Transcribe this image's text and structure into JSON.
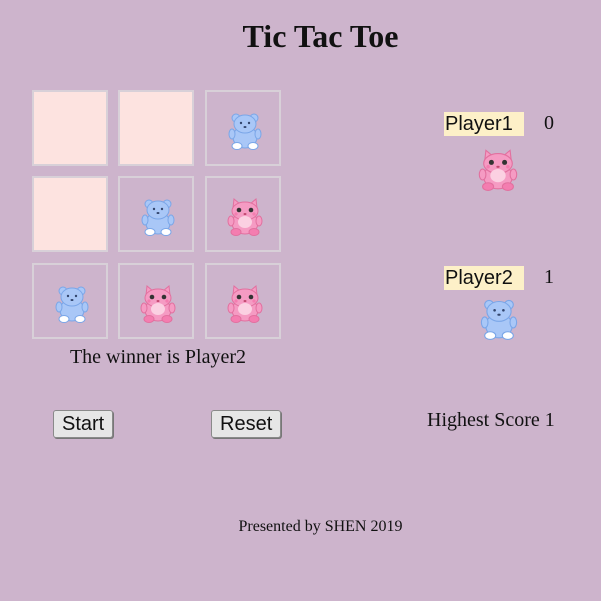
{
  "title": "Tic Tac Toe",
  "board": {
    "cells": [
      "",
      "",
      "blue",
      "",
      "blue",
      "pink",
      "blue",
      "pink",
      "pink"
    ]
  },
  "status": "The winner is Player2",
  "buttons": {
    "start": "Start",
    "reset": "Reset"
  },
  "players": [
    {
      "label": "Player1",
      "score": "0",
      "piece": "pink",
      "icon": "pink-bear-icon"
    },
    {
      "label": "Player2",
      "score": "1",
      "piece": "blue",
      "icon": "blue-bear-icon"
    }
  ],
  "highest_score": "Highest Score 1",
  "footer": "Presented by SHEN 2019",
  "colors": {
    "background": "#cdb4cc",
    "empty_cell": "#fde3e0",
    "player_label_bg": "#fdf0c8",
    "blue_piece": "#a9c7f7",
    "pink_piece": "#f59bc3"
  }
}
